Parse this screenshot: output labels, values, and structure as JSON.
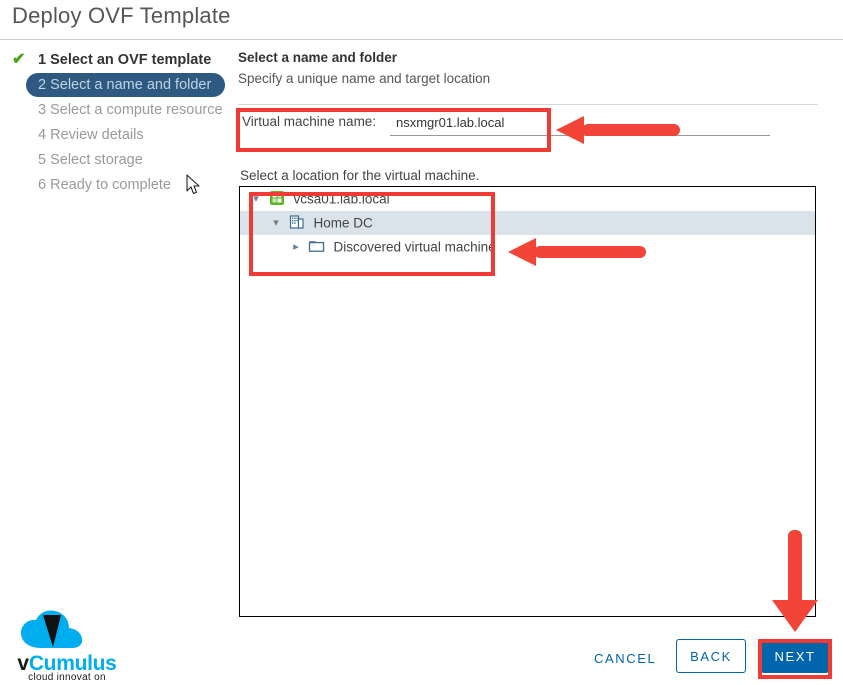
{
  "window": {
    "title": "Deploy OVF Template"
  },
  "steps": [
    {
      "label": "1 Select an OVF template",
      "state": "done",
      "icon": "check-icon"
    },
    {
      "label": "2 Select a name and folder",
      "state": "active"
    },
    {
      "label": "3 Select a compute resource",
      "state": "pending"
    },
    {
      "label": "4 Review details",
      "state": "pending"
    },
    {
      "label": "5 Select storage",
      "state": "pending"
    },
    {
      "label": "6 Ready to complete",
      "state": "pending"
    }
  ],
  "pane": {
    "title": "Select a name and folder",
    "subtitle": "Specify a unique name and target location",
    "vm_name_label": "Virtual machine name:",
    "vm_name_value": "nsxmgr01.lab.local",
    "vm_name_placeholder": "",
    "location_label": "Select a location for the virtual machine."
  },
  "tree": [
    {
      "label": "vcsa01.lab.local",
      "icon": "vcenter-icon",
      "twisty": "expanded",
      "level": 1,
      "selected": false
    },
    {
      "label": "Home DC",
      "icon": "datacenter-icon",
      "twisty": "expanded",
      "level": 2,
      "selected": true
    },
    {
      "label": "Discovered virtual machine",
      "icon": "folder-icon",
      "twisty": "collapsed",
      "level": 3,
      "selected": false
    }
  ],
  "footer": {
    "cancel_label": "CANCEL",
    "back_label": "BACK",
    "next_label": "NEXT"
  },
  "logo": {
    "word_prefix": "v",
    "word_main": "Cumulus",
    "tagline": "cloud innovat on"
  },
  "colors": {
    "accent_blue": "#0065ab",
    "active_step_bg": "#2e5a82",
    "annotation_red": "#ef3b34",
    "selected_row": "#dae3ea",
    "check_green": "#4aa516",
    "logo_cyan": "#00aeef"
  }
}
